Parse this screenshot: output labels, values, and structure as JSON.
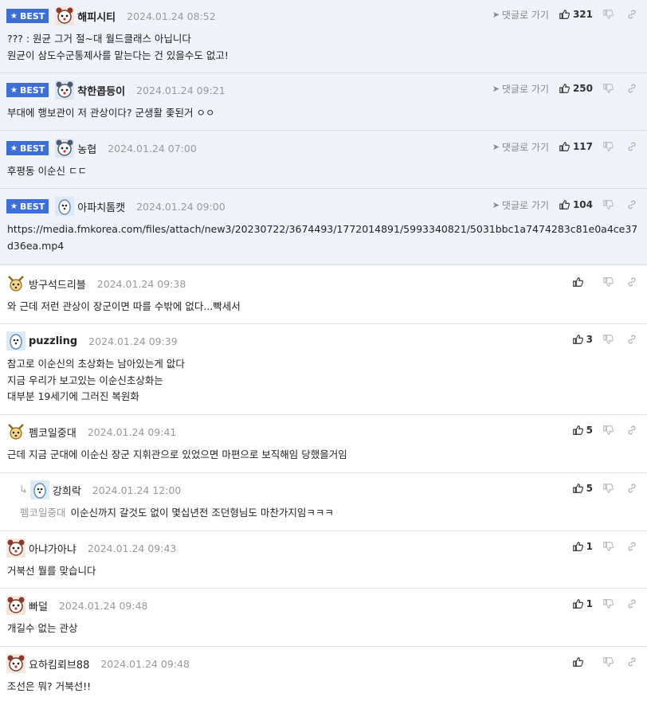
{
  "ui": {
    "best_label": "BEST",
    "reply_link": "댓글로 가기"
  },
  "comments": [
    {
      "type": "best",
      "nick": "해피시티",
      "date": "2024.01.24 08:52",
      "likes": "321",
      "lines": [
        "??? : 원균 그거 절~대 월드클래스 아닙니다",
        "원균이 삼도수군통제사를 맡는다는 건 있을수도 없고!"
      ]
    },
    {
      "type": "best",
      "nick": "착한콥등이",
      "date": "2024.01.24 09:21",
      "likes": "250",
      "lines": [
        "부대에 행보관이 저 관상이다? 군생활 좇된거 ㅇㅇ"
      ]
    },
    {
      "type": "best",
      "nick": "농협",
      "date": "2024.01.24 07:00",
      "likes": "117",
      "lines": [
        "후평동 이순신 ㄷㄷ"
      ]
    },
    {
      "type": "best",
      "nick": "아파치톰캣",
      "date": "2024.01.24 09:00",
      "likes": "104",
      "lines": [
        "https://media.fmkorea.com/files/attach/new3/20230722/3674493/1772014891/5993340821/5031bbc1a7474283c81e0a4ce37d36ea.mp4"
      ]
    },
    {
      "type": "normal",
      "nick": "방구석드리블",
      "date": "2024.01.24 09:38",
      "likes": "",
      "lines": [
        "와 근데 저런 관상이 장군이면 따를 수밖에 없다...빡세서"
      ]
    },
    {
      "type": "normal",
      "nick": "puzzling",
      "date": "2024.01.24 09:39",
      "likes": "3",
      "lines": [
        "참고로 이순신의 초상화는 남아있는게 앖다",
        "지금 우리가 보고있는 이순신초상화는",
        "대부분 19세기에 그러진 복원화"
      ]
    },
    {
      "type": "normal",
      "nick": "펨코일중대",
      "date": "2024.01.24 09:41",
      "likes": "5",
      "lines": [
        "근데 지금 군대에 이순신 장군 지휘관으로 있었으면 마편으로 보직해임 당했을거임"
      ]
    },
    {
      "type": "reply",
      "nick": "강희락",
      "date": "2024.01.24 12:00",
      "likes": "5",
      "mention": "펨코일중대",
      "lines": [
        "이순신까지 갈것도 없이 몇십년전 조던형님도 마찬가지임ㅋㅋㅋ"
      ]
    },
    {
      "type": "normal",
      "nick": "아냐가아냐",
      "date": "2024.01.24 09:43",
      "likes": "1",
      "lines": [
        "거북선 뭘를 맞습니다"
      ]
    },
    {
      "type": "normal",
      "nick": "빠덜",
      "date": "2024.01.24 09:48",
      "likes": "1",
      "lines": [
        "개길수 없는 관상"
      ]
    },
    {
      "type": "normal",
      "nick": "요하킴뢰브88",
      "date": "2024.01.24 09:48",
      "likes": "",
      "lines": [
        "조선은 뭐? 거북선!!"
      ]
    }
  ]
}
